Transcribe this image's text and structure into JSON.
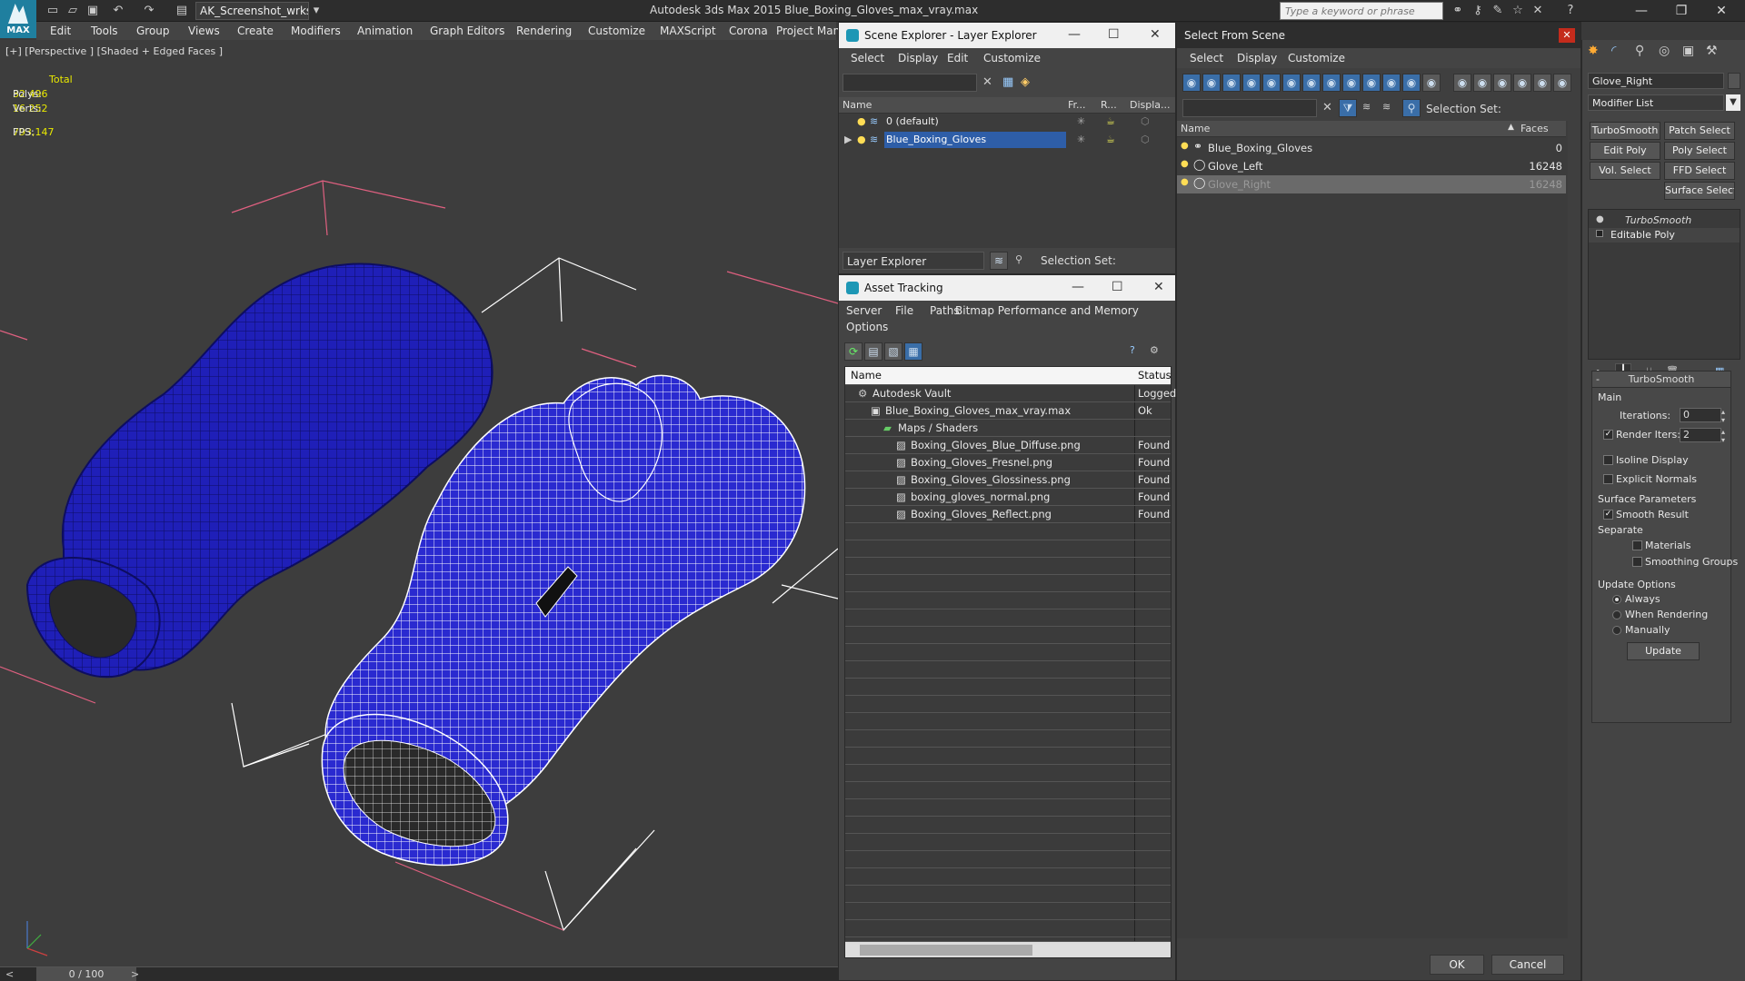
{
  "title_bar": {
    "logo_text": "MAX",
    "workspace": "AK_Screenshot_wrksp",
    "app_title": "Autodesk 3ds Max  2015    Blue_Boxing_Gloves_max_vray.max",
    "search_placeholder": "Type a keyword or phrase"
  },
  "menu": [
    "Edit",
    "Tools",
    "Group",
    "Views",
    "Create",
    "Modifiers",
    "Animation",
    "Graph Editors",
    "Rendering",
    "Customize",
    "MAXScript",
    "Corona",
    "Project Man"
  ],
  "viewport": {
    "label": "[+] [Perspective ] [Shaded + Edged Faces ]",
    "stats": {
      "total_label": "Total",
      "polys_label": "Polys:",
      "polys_value": "32 496",
      "verts_label": "Verts:",
      "verts_value": "16 252",
      "fps_label": "FPS:",
      "fps_value": "793,147"
    }
  },
  "timeline": {
    "counter": "0 / 100"
  },
  "scene_explorer": {
    "title": "Scene Explorer - Layer Explorer",
    "menu": [
      "Select",
      "Display",
      "Edit",
      "Customize"
    ],
    "columns": [
      "Name",
      "Fr...",
      "R...",
      "Displa..."
    ],
    "rows": [
      {
        "name": "0 (default)",
        "selected": false
      },
      {
        "name": "Blue_Boxing_Gloves",
        "selected": true
      }
    ],
    "footer_mode": "Layer Explorer",
    "footer_selection_set": "Selection Set:"
  },
  "asset_tracking": {
    "title": "Asset Tracking",
    "menu": [
      "Server",
      "File",
      "Paths",
      "Bitmap Performance and Memory",
      "Options"
    ],
    "columns": [
      "Name",
      "Status"
    ],
    "rows": [
      {
        "name": "Autodesk Vault",
        "status": "Logged",
        "indent": 0
      },
      {
        "name": "Blue_Boxing_Gloves_max_vray.max",
        "status": "Ok",
        "indent": 1
      },
      {
        "name": "Maps / Shaders",
        "status": "",
        "indent": 2
      },
      {
        "name": "Boxing_Gloves_Blue_Diffuse.png",
        "status": "Found",
        "indent": 3
      },
      {
        "name": "Boxing_Gloves_Fresnel.png",
        "status": "Found",
        "indent": 3
      },
      {
        "name": "Boxing_Gloves_Glossiness.png",
        "status": "Found",
        "indent": 3
      },
      {
        "name": "boxing_gloves_normal.png",
        "status": "Found",
        "indent": 3
      },
      {
        "name": "Boxing_Gloves_Reflect.png",
        "status": "Found",
        "indent": 3
      }
    ]
  },
  "select_from_scene": {
    "title": "Select From Scene",
    "menu": [
      "Select",
      "Display",
      "Customize"
    ],
    "selection_set_label": "Selection Set:",
    "columns": [
      "Name",
      "Faces"
    ],
    "rows": [
      {
        "name": "Blue_Boxing_Gloves",
        "faces": "0",
        "selected": false
      },
      {
        "name": "Glove_Left",
        "faces": "16248",
        "selected": false
      },
      {
        "name": "Glove_Right",
        "faces": "16248",
        "selected": true
      }
    ],
    "ok_label": "OK",
    "cancel_label": "Cancel"
  },
  "command_panel": {
    "object_name": "Glove_Right",
    "modifier_list": "Modifier List",
    "buttons": [
      "TurboSmooth",
      "Patch Select",
      "Edit Poly",
      "Poly Select",
      "Vol. Select",
      "FFD Select",
      "Surface Select"
    ],
    "stack": [
      "TurboSmooth",
      "Editable Poly"
    ],
    "turbosmooth": {
      "header": "TurboSmooth",
      "main_label": "Main",
      "iterations_label": "Iterations:",
      "iterations_value": "0",
      "render_iters_label": "Render Iters:",
      "render_iters_value": "2",
      "isoline_label": "Isoline Display",
      "explicit_label": "Explicit Normals",
      "surface_label": "Surface Parameters",
      "smooth_result_label": "Smooth Result",
      "separate_label": "Separate",
      "materials_label": "Materials",
      "smoothing_groups_label": "Smoothing Groups",
      "update_options_label": "Update Options",
      "always_label": "Always",
      "when_rendering_label": "When Rendering",
      "manually_label": "Manually",
      "update_button": "Update"
    }
  },
  "colors": {
    "glove_blue": "#1f1fb8",
    "wire_white": "#ffffff",
    "selection_blue": "#2e5ea8",
    "stat_yellow": "#e8e800",
    "bbox_pink": "#e06080"
  }
}
